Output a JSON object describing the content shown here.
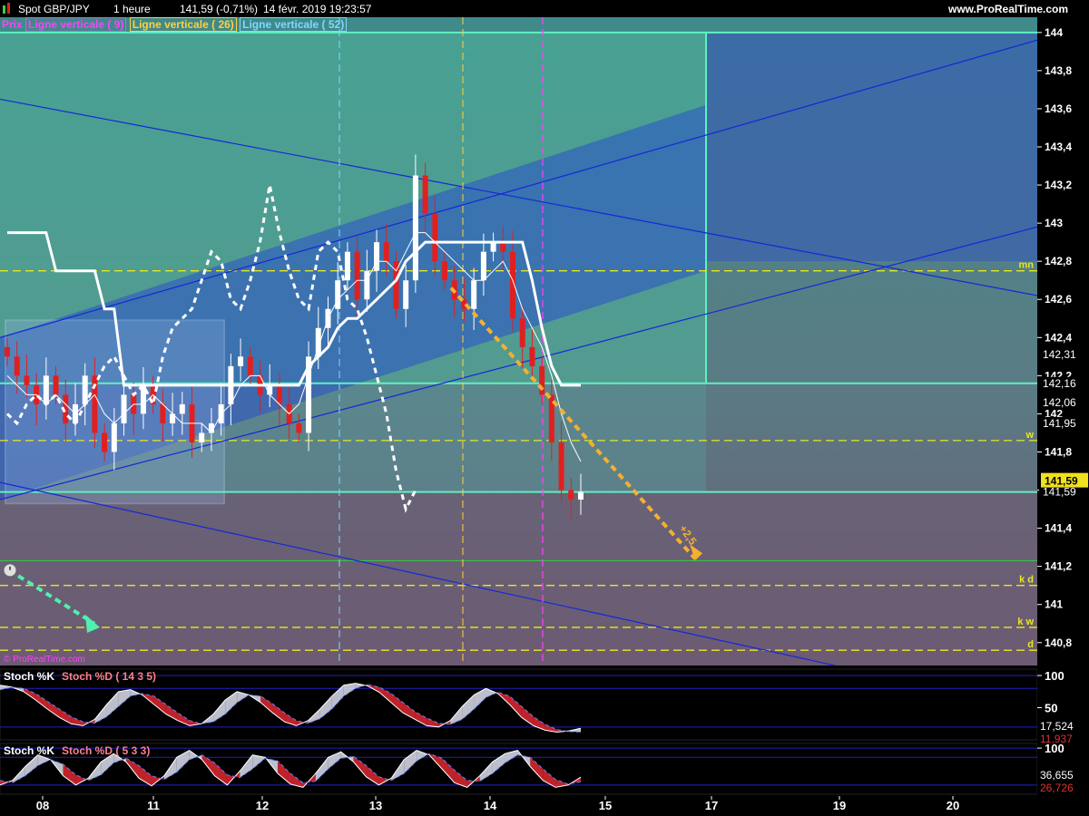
{
  "header": {
    "symbol": "Spot GBP/JPY",
    "timeframe": "1 heure",
    "last": "141,59 (-0,71%)",
    "datetime": "14 févr. 2019 19:23:57",
    "site": "www.ProRealTime.com"
  },
  "legend": {
    "prix": "Prix",
    "v9": "Ligne verticale ( 9)",
    "v26": "Ligne verticale ( 26)",
    "v52": "Ligne verticale ( 52)"
  },
  "watermark": "© ProRealTime.com",
  "colors": {
    "bull": "#ffffff",
    "bear": "#e02020",
    "cyan": "#5ff0c0",
    "channel": "#1428d8",
    "dashed_yellow": "#e8e820",
    "arrow_orange": "#f5b030",
    "arrow_green": "#50f0b0",
    "vline9": "#ff40ff",
    "vline26": "#ffd040",
    "vline52": "#80d8ff"
  },
  "chart_data": [
    {
      "type": "line",
      "title": "Spot GBP/JPY",
      "x_ticks": [
        "08",
        "11",
        "12",
        "13",
        "14",
        "15",
        "17",
        "19",
        "20"
      ],
      "ylim": [
        140.68,
        144.08
      ],
      "y_ticks": [
        "144",
        "143,8",
        "143,6",
        "143,4",
        "143,2",
        "143",
        "142,8",
        "142,6",
        "142,4",
        "142,2",
        "142",
        "141,8",
        "141,6",
        "141,4",
        "141,2",
        "141",
        "140,8"
      ],
      "price_tags": [
        {
          "label": "142,31",
          "y": 142.31
        },
        {
          "label": "142,16",
          "y": 142.16
        },
        {
          "label": "142,06",
          "y": 142.06
        },
        {
          "label": "141,95",
          "y": 141.95
        },
        {
          "label": "141,59",
          "y": 141.59
        }
      ],
      "current_price": {
        "label": "141,59",
        "y": 141.59
      },
      "levels": [
        {
          "label": "mn",
          "y": 142.75
        },
        {
          "label": "w",
          "y": 141.86
        },
        {
          "label": "k d",
          "y": 141.1
        },
        {
          "label": "k w",
          "y": 140.88
        },
        {
          "label": "d",
          "y": 140.76
        }
      ],
      "annotations": [
        "+2,5"
      ],
      "close": [
        142.3,
        142.2,
        142.15,
        142.05,
        142.2,
        142.1,
        141.95,
        142.05,
        142.2,
        141.9,
        141.8,
        141.95,
        142.1,
        142.0,
        142.15,
        142.05,
        141.95,
        142.0,
        142.05,
        141.85,
        141.9,
        141.95,
        142.05,
        142.25,
        142.3,
        142.2,
        142.1,
        142.15,
        142.05,
        141.95,
        141.9,
        142.3,
        142.45,
        142.55,
        142.7,
        142.85,
        142.6,
        142.75,
        142.9,
        142.8,
        142.55,
        142.7,
        143.25,
        143.05,
        142.8,
        142.7,
        142.6,
        142.55,
        142.7,
        142.85,
        142.9,
        142.85,
        142.5,
        142.35,
        142.25,
        142.1,
        141.85,
        141.6,
        141.55,
        141.59
      ],
      "tenkan": [
        142.2,
        142.15,
        142.1,
        142.1,
        142.05,
        142.1,
        142.05,
        142.0,
        142.05,
        142.1,
        142.0,
        141.95,
        142.0,
        142.05,
        142.05,
        142.1,
        142.05,
        142.0,
        141.95,
        141.95,
        141.95,
        141.9,
        142.0,
        142.05,
        142.15,
        142.2,
        142.2,
        142.1,
        142.05,
        142.0,
        142.05,
        142.2,
        142.35,
        142.5,
        142.6,
        142.65,
        142.7,
        142.7,
        142.8,
        142.8,
        142.75,
        142.85,
        142.95,
        142.95,
        142.9,
        142.85,
        142.8,
        142.75,
        142.7,
        142.7,
        142.75,
        142.8,
        142.7,
        142.55,
        142.45,
        142.35,
        142.2,
        142.0,
        141.85,
        141.75
      ],
      "kijun": [
        142.95,
        142.95,
        142.95,
        142.95,
        142.95,
        142.75,
        142.75,
        142.75,
        142.75,
        142.75,
        142.55,
        142.55,
        142.15,
        142.15,
        142.15,
        142.15,
        142.15,
        142.15,
        142.15,
        142.15,
        142.15,
        142.15,
        142.15,
        142.15,
        142.15,
        142.15,
        142.15,
        142.15,
        142.15,
        142.15,
        142.15,
        142.25,
        142.3,
        142.35,
        142.45,
        142.5,
        142.5,
        142.55,
        142.6,
        142.65,
        142.7,
        142.8,
        142.85,
        142.9,
        142.9,
        142.9,
        142.9,
        142.9,
        142.9,
        142.9,
        142.9,
        142.9,
        142.9,
        142.9,
        142.7,
        142.45,
        142.25,
        142.15,
        142.15,
        142.15
      ],
      "chikou": [
        142.0,
        141.95,
        142.05,
        142.1,
        142.05,
        142.1,
        142.0,
        141.95,
        142.05,
        142.15,
        142.25,
        142.3,
        142.2,
        142.1,
        142.15,
        142.05,
        142.3,
        142.45,
        142.5,
        142.55,
        142.7,
        142.85,
        142.8,
        142.6,
        142.55,
        142.7,
        142.9,
        143.2,
        142.95,
        142.75,
        142.6,
        142.55,
        142.85,
        142.9,
        142.85,
        142.6,
        142.55,
        142.4,
        142.2,
        142.0,
        141.7,
        141.5,
        141.6
      ]
    },
    {
      "type": "area",
      "title": "Stoch %K Stoch %D ( 14 3 5)",
      "ylim": [
        0,
        110
      ],
      "y_ticks": [
        "100",
        "50"
      ],
      "value_tags": [
        "17,524",
        "11,937"
      ],
      "k": [
        85,
        82,
        75,
        62,
        48,
        35,
        25,
        22,
        32,
        55,
        75,
        78,
        70,
        55,
        40,
        30,
        22,
        25,
        40,
        62,
        75,
        70,
        58,
        42,
        28,
        22,
        30,
        48,
        68,
        85,
        88,
        84,
        74,
        58,
        42,
        32,
        22,
        20,
        30,
        52,
        70,
        80,
        72,
        55,
        35,
        22,
        15,
        12,
        14,
        18
      ],
      "d": [
        78,
        82,
        80,
        72,
        60,
        48,
        36,
        28,
        26,
        36,
        52,
        68,
        72,
        68,
        55,
        42,
        30,
        25,
        28,
        40,
        58,
        70,
        68,
        56,
        42,
        30,
        26,
        33,
        48,
        68,
        80,
        86,
        82,
        72,
        58,
        44,
        34,
        26,
        24,
        32,
        48,
        66,
        74,
        68,
        52,
        36,
        24,
        16,
        13,
        12
      ]
    },
    {
      "type": "area",
      "title": "Stoch %K Stoch %D ( 5 3 3)",
      "ylim": [
        0,
        110
      ],
      "y_ticks": [
        "100"
      ],
      "value_tags": [
        "36,655",
        "26,726"
      ],
      "k": [
        20,
        30,
        60,
        85,
        75,
        40,
        20,
        35,
        70,
        88,
        70,
        35,
        18,
        40,
        80,
        95,
        75,
        40,
        20,
        50,
        85,
        80,
        45,
        22,
        15,
        45,
        80,
        92,
        70,
        38,
        20,
        35,
        75,
        95,
        85,
        55,
        25,
        15,
        40,
        70,
        88,
        95,
        60,
        30,
        15,
        20,
        37
      ],
      "d": [
        30,
        25,
        40,
        62,
        75,
        65,
        42,
        30,
        42,
        68,
        78,
        62,
        40,
        32,
        48,
        75,
        85,
        68,
        42,
        36,
        55,
        78,
        72,
        45,
        25,
        28,
        55,
        78,
        82,
        62,
        38,
        30,
        45,
        72,
        88,
        78,
        52,
        30,
        28,
        45,
        68,
        85,
        80,
        55,
        32,
        22,
        27
      ]
    }
  ]
}
